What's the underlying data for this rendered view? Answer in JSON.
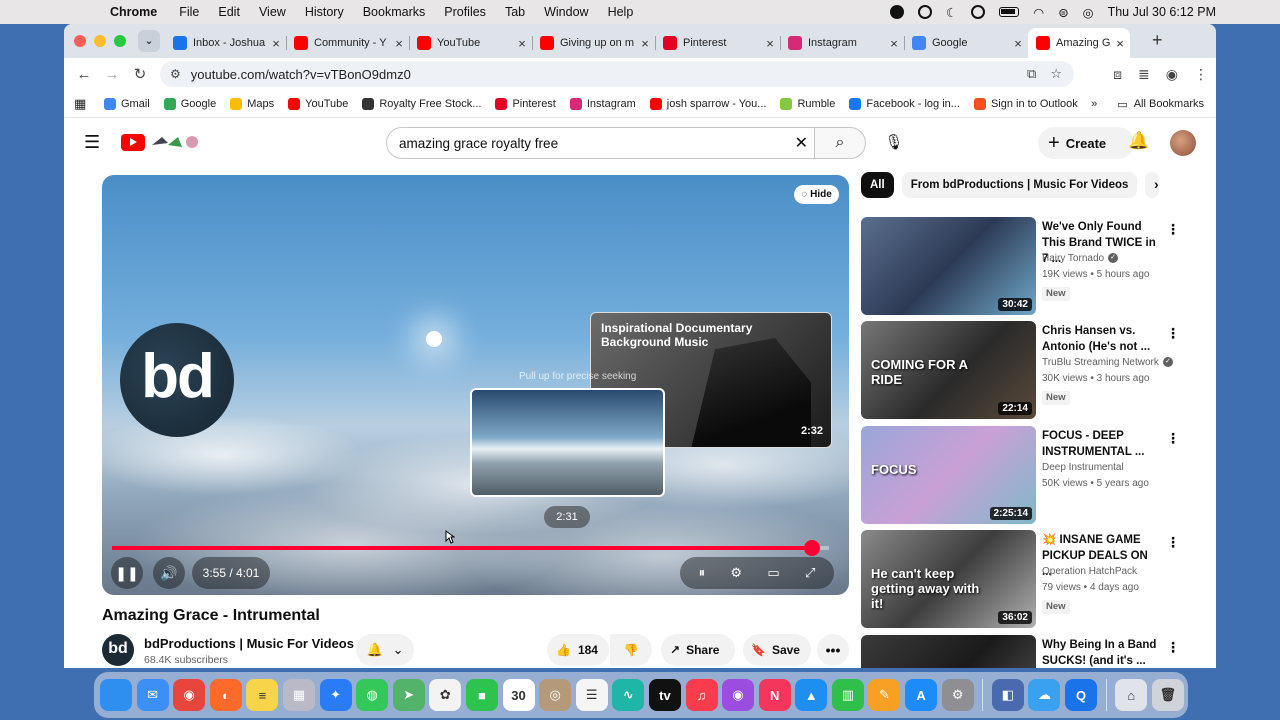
{
  "menubar": {
    "items": [
      "Chrome",
      "File",
      "Edit",
      "View",
      "History",
      "Bookmarks",
      "Profiles",
      "Tab",
      "Window",
      "Help"
    ],
    "datetime": "Thu Jul 30  6:12 PM"
  },
  "tabs": [
    {
      "title": "Inbox - Joshua",
      "color": "#1a73e8"
    },
    {
      "title": "Community - Y",
      "color": "#ff0000"
    },
    {
      "title": "YouTube",
      "color": "#ff0000"
    },
    {
      "title": "Giving up on m",
      "color": "#ff0000"
    },
    {
      "title": "Pinterest",
      "color": "#e60023"
    },
    {
      "title": "Instagram",
      "color": "#d62976"
    },
    {
      "title": "Google",
      "color": "#4285f4"
    },
    {
      "title": "Amazing G",
      "color": "#ff0000"
    }
  ],
  "omnibox": {
    "url": "youtube.com/watch?v=vTBonO9dmz0"
  },
  "bookmarks": {
    "items": [
      {
        "label": "Gmail",
        "color": "#4285f4"
      },
      {
        "label": "Google",
        "color": "#34a853"
      },
      {
        "label": "Maps",
        "color": "#fbbc04"
      },
      {
        "label": "YouTube",
        "color": "#ff0000"
      },
      {
        "label": "Royalty Free Stock...",
        "color": "#333333"
      },
      {
        "label": "Pinterest",
        "color": "#e60023"
      },
      {
        "label": "Instagram",
        "color": "#d62976"
      },
      {
        "label": "josh sparrow - You...",
        "color": "#ff0000"
      },
      {
        "label": "Rumble",
        "color": "#85c742"
      },
      {
        "label": "Facebook - log in...",
        "color": "#1877f2"
      },
      {
        "label": "Sign in to Outlook",
        "color": "#f25022"
      }
    ],
    "overflow": "»",
    "all_bookmarks": "All Bookmarks"
  },
  "youtube": {
    "search_query": "amazing grace royalty free",
    "create_label": "Create",
    "player": {
      "hide_label": "Hide",
      "logo_text": "bd",
      "endcard_title": "Inspirational Documentary Background Music",
      "endcard_duration": "2:32",
      "seek_hint": "Pull up for precise seeking",
      "preview_time": "2:31",
      "time_display": "3:55 / 4:01",
      "progress_fraction": 0.976
    },
    "video_title": "Amazing Grace - Intrumental",
    "channel": {
      "avatar_text": "bd",
      "name": "bdProductions | Music For Videos",
      "subscribers": "68.4K subscribers"
    },
    "actions": {
      "likes": "184",
      "share": "Share",
      "save": "Save"
    },
    "chips": [
      "All",
      "From bdProductions | Music For Videos"
    ],
    "recommendations": [
      {
        "title": "We've Only Found This Brand TWICE in 7 ...",
        "channel": "Hairy Tornado",
        "verified": true,
        "meta": "19K views • 5 hours ago",
        "badge": "New",
        "duration": "30:42",
        "thumb_text": "",
        "thumb_bg": "linear-gradient(135deg,#5b6f8e,#2c3a55 50%,#6fa8c9)"
      },
      {
        "title": "Chris Hansen vs. Antonio (He's not ...",
        "channel": "TruBlu Streaming Network",
        "verified": true,
        "meta": "30K views • 3 hours ago",
        "badge": "New",
        "duration": "22:14",
        "thumb_text": "COMING FOR A RIDE",
        "thumb_bg": "linear-gradient(135deg,#777,#2a2a2a 55%,#5a4a3a)"
      },
      {
        "title": "FOCUS - DEEP INSTRUMENTAL ...",
        "channel": "Deep Instrumental",
        "verified": false,
        "meta": "50K views • 5 years ago",
        "badge": "",
        "duration": "2:25:14",
        "thumb_text": "FOCUS",
        "thumb_bg": "linear-gradient(135deg,#9aa6d8,#c9a0d6 50%,#7fb9c9)"
      },
      {
        "title": "💥 INSANE GAME PICKUP DEALS ON ...",
        "channel": "Operation HatchPack",
        "verified": false,
        "meta": "79 views • 4 days ago",
        "badge": "New",
        "duration": "36:02",
        "thumb_text": "He can't keep getting away with it!",
        "thumb_bg": "linear-gradient(135deg,#8a8a8a,#3d3d3d 50%,#b0b0b0)"
      },
      {
        "title": "Why Being In a Band SUCKS! (and it's ...",
        "channel": "",
        "verified": false,
        "meta": "",
        "badge": "",
        "duration": "",
        "thumb_text": "",
        "thumb_bg": "linear-gradient(135deg,#3b3b3b,#1a1a1a 50%,#5a5a5a)"
      }
    ]
  },
  "dock": {
    "apps": [
      {
        "name": "finder",
        "color": "#2f8ff0",
        "glyph": ""
      },
      {
        "name": "mail",
        "color": "#3b8ff5",
        "glyph": "✉"
      },
      {
        "name": "chrome",
        "color": "#e8453c",
        "glyph": "◉"
      },
      {
        "name": "firefox",
        "color": "#ff6a2a",
        "glyph": "◐"
      },
      {
        "name": "notes",
        "color": "#f7d44a",
        "glyph": "≡"
      },
      {
        "name": "launchpad",
        "color": "#b9b9c8",
        "glyph": "▦"
      },
      {
        "name": "safari",
        "color": "#2a7cf6",
        "glyph": "✦"
      },
      {
        "name": "messages",
        "color": "#34c759",
        "glyph": "◍"
      },
      {
        "name": "maps",
        "color": "#54b36a",
        "glyph": "➤"
      },
      {
        "name": "photos",
        "color": "#f3f3f3",
        "glyph": "✿"
      },
      {
        "name": "facetime",
        "color": "#2ec24f",
        "glyph": "■"
      },
      {
        "name": "calendar",
        "color": "#ffffff",
        "glyph": "30"
      },
      {
        "name": "contacts",
        "color": "#b49a7a",
        "glyph": "◎"
      },
      {
        "name": "reminders",
        "color": "#f5f5f5",
        "glyph": "☰"
      },
      {
        "name": "freeform",
        "color": "#1fb6a8",
        "glyph": "∿"
      },
      {
        "name": "tv",
        "color": "#111111",
        "glyph": "tv"
      },
      {
        "name": "music",
        "color": "#fa3c4c",
        "glyph": "♫"
      },
      {
        "name": "podcasts",
        "color": "#9b4de0",
        "glyph": "◉"
      },
      {
        "name": "news",
        "color": "#f5365c",
        "glyph": "N"
      },
      {
        "name": "keynote",
        "color": "#1f8ef1",
        "glyph": "▲"
      },
      {
        "name": "numbers",
        "color": "#2fbf4a",
        "glyph": "▥"
      },
      {
        "name": "pages",
        "color": "#f7a024",
        "glyph": "✎"
      },
      {
        "name": "app-store",
        "color": "#1d8cf8",
        "glyph": "A"
      },
      {
        "name": "system-settings",
        "color": "#8e8e93",
        "glyph": "⚙"
      },
      {
        "name": "sep",
        "color": "",
        "glyph": ""
      },
      {
        "name": "image-capture",
        "color": "#4a6ab0",
        "glyph": "◧"
      },
      {
        "name": "weather",
        "color": "#3aa0f0",
        "glyph": "☁"
      },
      {
        "name": "quicktime",
        "color": "#1a73e8",
        "glyph": "Q"
      },
      {
        "name": "sep",
        "color": "",
        "glyph": ""
      },
      {
        "name": "downloads",
        "color": "#e0e4ea",
        "glyph": "⌂"
      },
      {
        "name": "trash",
        "color": "#d0d4da",
        "glyph": "🗑"
      }
    ]
  }
}
